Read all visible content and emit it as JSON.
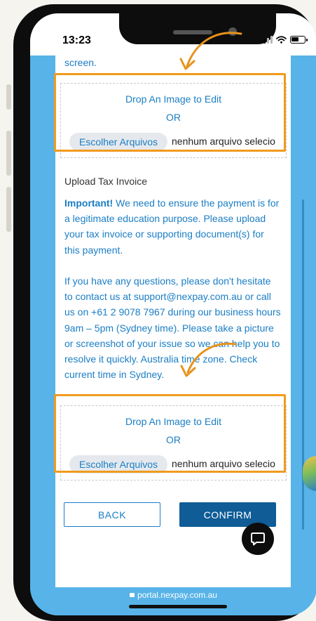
{
  "status_bar": {
    "time": "13:23"
  },
  "page": {
    "previous_text": "screen.",
    "dropzone_1": {
      "title": "Drop An Image to Edit",
      "or": "OR",
      "file_button": "Escolher Arquivos",
      "file_status": "nenhum arquivo selecio"
    },
    "upload_label": "Upload Tax Invoice",
    "important": {
      "bold": "Important!",
      "text": " We need to ensure the payment is for a legitimate education purpose. Please upload your tax invoice or supporting document(s) for this payment."
    },
    "help_text": "If you have any questions, please don't hesitate to contact us at support@nexpay.com.au  or call us on +61 2 9078 7967 during our business hours 9am – 5pm (Sydney time). Please take a picture or screenshot of your issue so we can help you to resolve it quickly. Australia time zone. Check current time in Sydney.",
    "dropzone_2": {
      "title": "Drop An Image to Edit",
      "or": "OR",
      "file_button": "Escolher Arquivos",
      "file_status": "nenhum arquivo selecio"
    },
    "back_label": "BACK",
    "confirm_label": "CONFIRM"
  },
  "browser": {
    "url": "portal.nexpay.com.au"
  },
  "colors": {
    "accent": "#1b7ec4",
    "confirm": "#0f5c96",
    "highlight": "#f19b1e",
    "frame_blue": "#57b3e8"
  },
  "icons": [
    "signal-icon",
    "wifi-icon",
    "battery-icon",
    "chat-icon",
    "lock-icon",
    "arrow-annotation-icon"
  ]
}
